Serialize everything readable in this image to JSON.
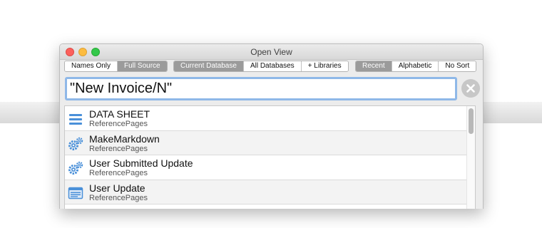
{
  "window": {
    "title": "Open View"
  },
  "scope_group": [
    {
      "label": "Names Only",
      "active": false
    },
    {
      "label": "Full Source",
      "active": true
    }
  ],
  "database_group": [
    {
      "label": "Current Database",
      "active": true
    },
    {
      "label": "All Databases",
      "active": false
    },
    {
      "label": "+ Libraries",
      "active": false
    }
  ],
  "sort_group": [
    {
      "label": "Recent",
      "active": true
    },
    {
      "label": "Alphabetic",
      "active": false
    },
    {
      "label": "No Sort",
      "active": false
    }
  ],
  "search": {
    "value": "\"New Invoice/N\""
  },
  "results": [
    {
      "name": "DATA SHEET",
      "source": "ReferencePages",
      "icon": "list-lines-icon"
    },
    {
      "name": "MakeMarkdown",
      "source": "ReferencePages",
      "icon": "gears-icon"
    },
    {
      "name": "User Submitted Update",
      "source": "ReferencePages",
      "icon": "gears-icon"
    },
    {
      "name": "User Update",
      "source": "ReferencePages",
      "icon": "form-icon"
    }
  ],
  "colors": {
    "icon_blue": "#4a90d9",
    "search_focus": "#8fb8e8",
    "active_segment": "#9b9b9b"
  }
}
